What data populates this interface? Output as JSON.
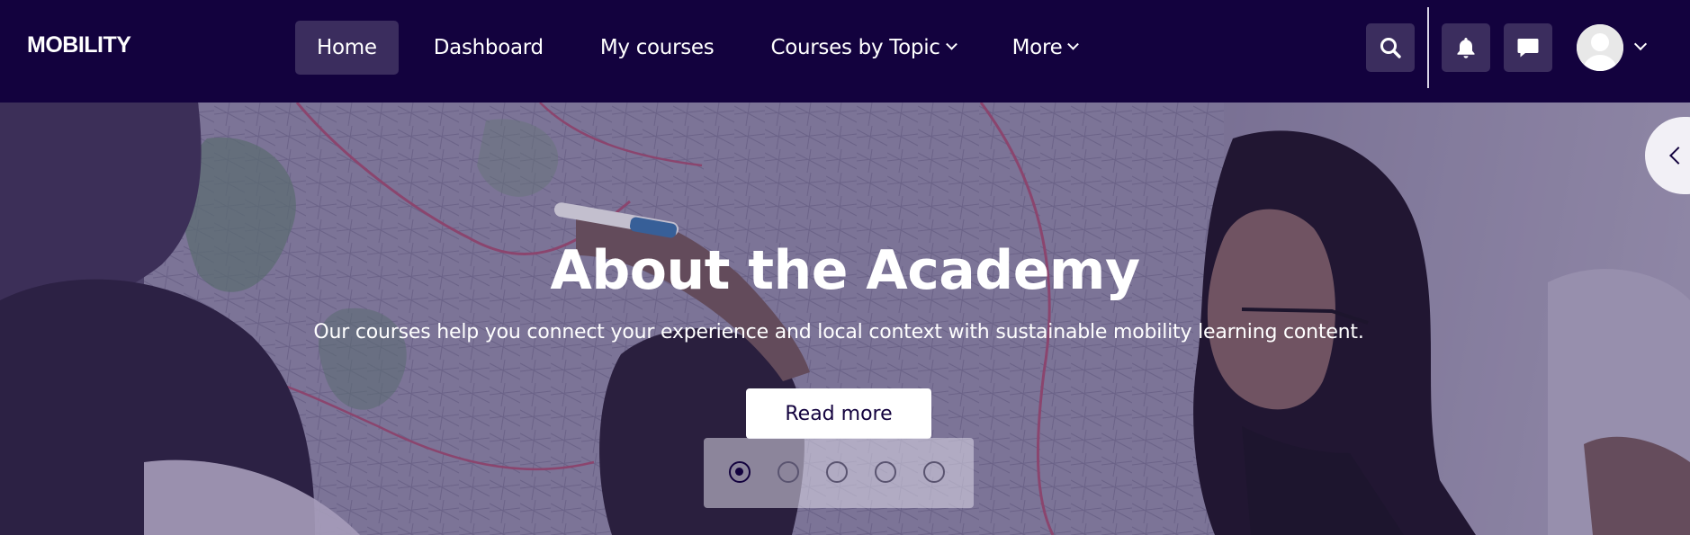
{
  "brand": {
    "name": "MOBILITY"
  },
  "nav": {
    "items": [
      {
        "label": "Home",
        "active": true
      },
      {
        "label": "Dashboard",
        "active": false
      },
      {
        "label": "My courses",
        "active": false
      },
      {
        "label": "Courses by Topic",
        "active": false,
        "dropdown": true
      },
      {
        "label": "More",
        "active": false,
        "dropdown": true
      }
    ]
  },
  "header_icons": {
    "search": "search-icon",
    "notifications": "bell-icon",
    "messages": "chat-icon",
    "user": "avatar-icon"
  },
  "hero": {
    "title": "About the Academy",
    "subtitle": "Our courses help you connect your experience and local context with sustainable mobility learning content.",
    "cta_label": "Read more",
    "slide_count": 5,
    "active_slide": 1
  },
  "colors": {
    "navbar": "#13023e",
    "active_nav": "#3b2d5e",
    "text_light": "#ffffff"
  }
}
